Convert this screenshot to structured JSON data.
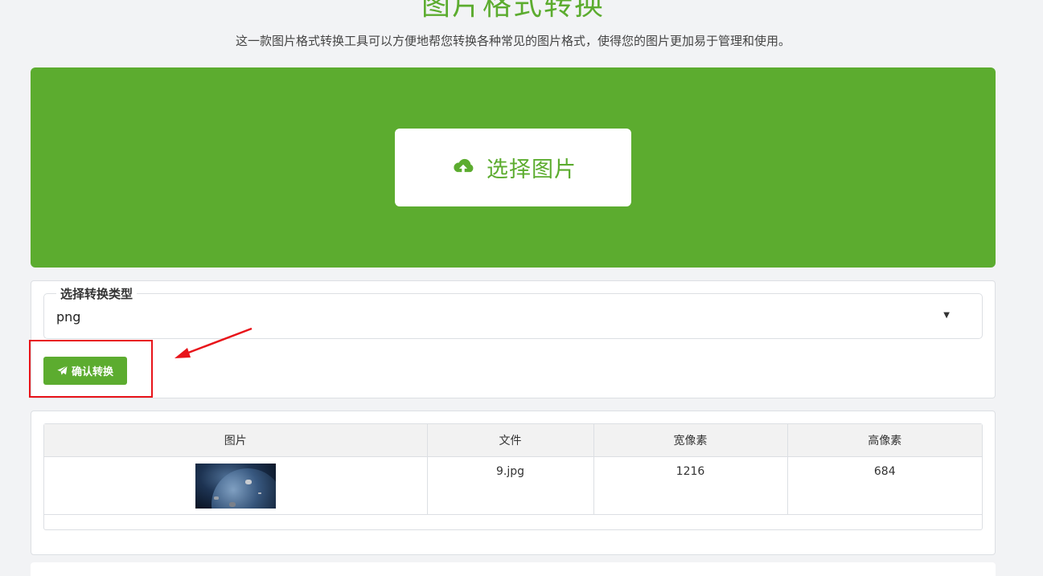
{
  "header": {
    "title": "图片格式转换",
    "subtitle": "这一款图片格式转换工具可以方便地帮您转换各种常见的图片格式，使得您的图片更加易于管理和使用。"
  },
  "upload": {
    "button_label": "选择图片",
    "icon": "cloud-upload-icon"
  },
  "convert": {
    "legend": "选择转换类型",
    "selected_type": "png",
    "caret": "▼",
    "confirm_label": "确认转换",
    "confirm_icon": "paper-plane-icon"
  },
  "table": {
    "columns": [
      "图片",
      "文件",
      "宽像素",
      "高像素"
    ],
    "rows": [
      {
        "file": "9.jpg",
        "width": "1216",
        "height": "684"
      }
    ]
  },
  "colors": {
    "accent": "#5cac2f",
    "highlight": "#e8141a"
  }
}
